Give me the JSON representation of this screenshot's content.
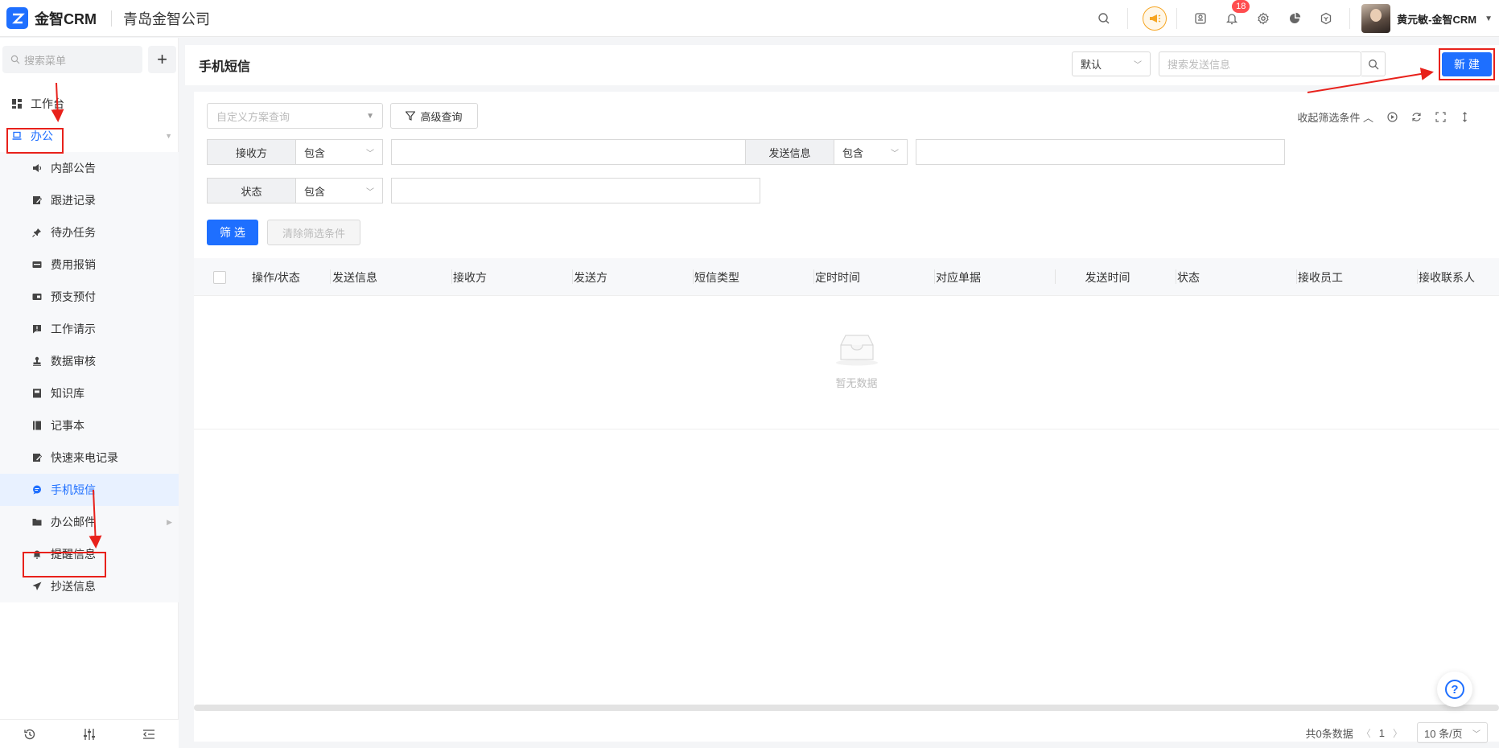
{
  "app": {
    "logo_text": "金智CRM",
    "company": "青岛金智公司"
  },
  "topbar": {
    "notification_count": "18",
    "user_name": "黄元敏-金智CRM"
  },
  "sidebar": {
    "search_placeholder": "搜索菜单",
    "workbench": "工作台",
    "office": "办公",
    "sub_items": [
      {
        "label": "内部公告"
      },
      {
        "label": "跟进记录"
      },
      {
        "label": "待办任务"
      },
      {
        "label": "费用报销"
      },
      {
        "label": "预支预付"
      },
      {
        "label": "工作请示"
      },
      {
        "label": "数据审核"
      },
      {
        "label": "知识库"
      },
      {
        "label": "记事本"
      },
      {
        "label": "快速来电记录"
      },
      {
        "label": "手机短信"
      },
      {
        "label": "办公邮件"
      },
      {
        "label": "提醒信息"
      },
      {
        "label": "抄送信息"
      }
    ]
  },
  "header": {
    "title": "手机短信",
    "view_select": "默认",
    "search_placeholder": "搜索发送信息",
    "new_button": "新 建"
  },
  "filters": {
    "scheme_placeholder": "自定义方案查询",
    "advanced_button": "高级查询",
    "collapse_label": "收起筛选条件",
    "row1": {
      "label1": "接收方",
      "op1": "包含",
      "label2": "发送信息",
      "op2": "包含"
    },
    "row2": {
      "label1": "状态",
      "op1": "包含"
    },
    "filter_button": "筛 选",
    "clear_button": "清除筛选条件"
  },
  "table": {
    "columns": [
      "操作/状态",
      "发送信息",
      "接收方",
      "发送方",
      "短信类型",
      "定时时间",
      "对应单据",
      "发送时间",
      "状态",
      "接收员工",
      "接收联系人"
    ],
    "empty_text": "暂无数据"
  },
  "pagination": {
    "total_text": "共0条数据",
    "page": "1",
    "page_size": "10 条/页"
  }
}
